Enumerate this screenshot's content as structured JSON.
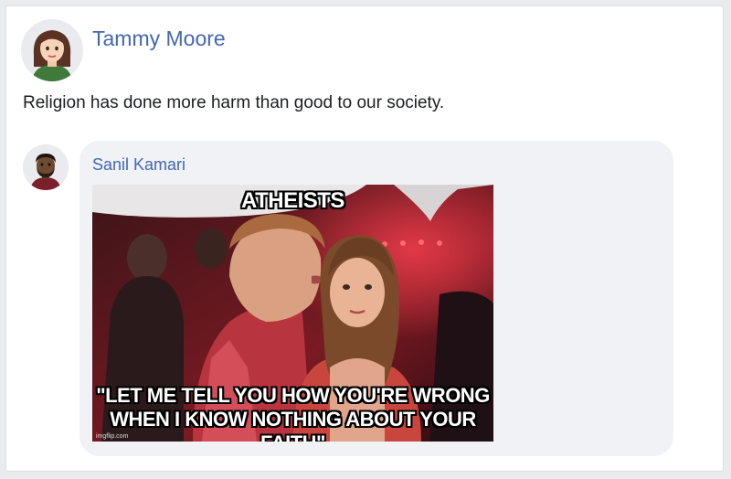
{
  "post": {
    "author": "Tammy Moore",
    "avatar_icon": "female-avatar-icon",
    "text": "Religion has done more harm than good to our society."
  },
  "comment": {
    "author": "Sanil Kamari",
    "avatar_icon": "male-avatar-icon",
    "meme": {
      "top_caption": "ATHEISTS",
      "bottom_caption_line1": "\"LET ME TELL YOU HOW YOU'RE WRONG",
      "bottom_caption_line2": "WHEN I KNOW NOTHING ABOUT YOUR FAITH\"",
      "watermark": "imgflip.com"
    }
  },
  "colors": {
    "link": "#4267b2",
    "bubble": "#f0f2f5",
    "page_bg": "#e9ebee"
  }
}
